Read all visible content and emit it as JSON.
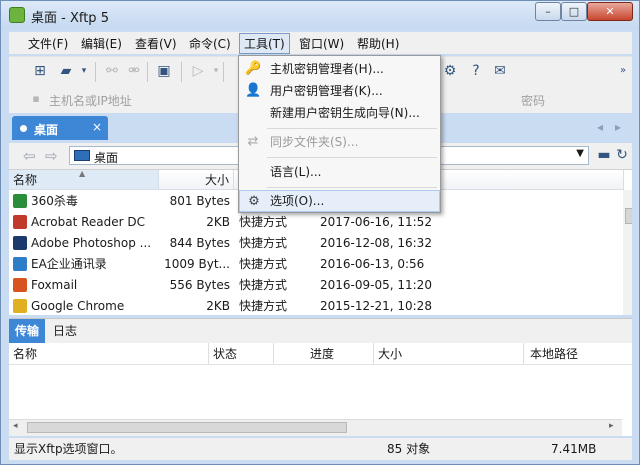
{
  "window": {
    "title": "桌面 - Xftp 5",
    "minimize": "–",
    "maximize": "□",
    "close": "✕"
  },
  "menu": [
    "文件(F)",
    "编辑(E)",
    "查看(V)",
    "命令(C)",
    "工具(T)",
    "窗口(W)",
    "帮助(H)"
  ],
  "address": {
    "host_placeholder": "主机名或IP地址",
    "password_placeholder": "密码"
  },
  "tab": {
    "label": "桌面",
    "close": "×"
  },
  "path": {
    "current": "桌面"
  },
  "filelist": {
    "headers": {
      "name": "名称",
      "size": "大小"
    },
    "rows": [
      {
        "name": "360杀毒",
        "size": "801 Bytes",
        "type": "",
        "date": "",
        "icon_color": "#2a8d3a"
      },
      {
        "name": "Acrobat Reader DC",
        "size": "2KB",
        "type": "快捷方式",
        "date": "2017-06-16, 11:52",
        "icon_color": "#c0392b"
      },
      {
        "name": "Adobe Photoshop ...",
        "size": "844 Bytes",
        "type": "快捷方式",
        "date": "2016-12-08, 16:32",
        "icon_color": "#1b3a6b"
      },
      {
        "name": "EA企业通讯录",
        "size": "1009 Byt...",
        "type": "快捷方式",
        "date": "2016-06-13, 0:56",
        "icon_color": "#2f7dc6"
      },
      {
        "name": "Foxmail",
        "size": "556 Bytes",
        "type": "快捷方式",
        "date": "2016-09-05, 11:20",
        "icon_color": "#d8531f"
      },
      {
        "name": "Google Chrome",
        "size": "2KB",
        "type": "快捷方式",
        "date": "2015-12-21, 10:28",
        "icon_color": "#e0b020"
      }
    ]
  },
  "lower_tabs": [
    "传输",
    "日志"
  ],
  "transfer": {
    "headers": [
      "名称",
      "状态",
      "进度",
      "大小",
      "本地路径"
    ]
  },
  "status": {
    "message": "显示Xftp选项窗口。",
    "count": "85 对象",
    "size": "7.41MB"
  },
  "tools_menu": {
    "items": [
      {
        "label": "主机密钥管理者(H)...",
        "icon": "host-key-manager-icon",
        "enabled": true
      },
      {
        "label": "用户密钥管理者(K)...",
        "icon": "user-key-manager-icon",
        "enabled": true
      },
      {
        "label": "新建用户密钥生成向导(N)...",
        "icon": "",
        "enabled": true
      },
      {
        "label": "同步文件夹(S)...",
        "icon": "sync-folder-icon",
        "enabled": false
      },
      {
        "label": "语言(L)...",
        "icon": "",
        "enabled": true
      },
      {
        "label": "选项(O)...",
        "icon": "gear-icon",
        "enabled": true,
        "highlighted": true
      }
    ]
  }
}
